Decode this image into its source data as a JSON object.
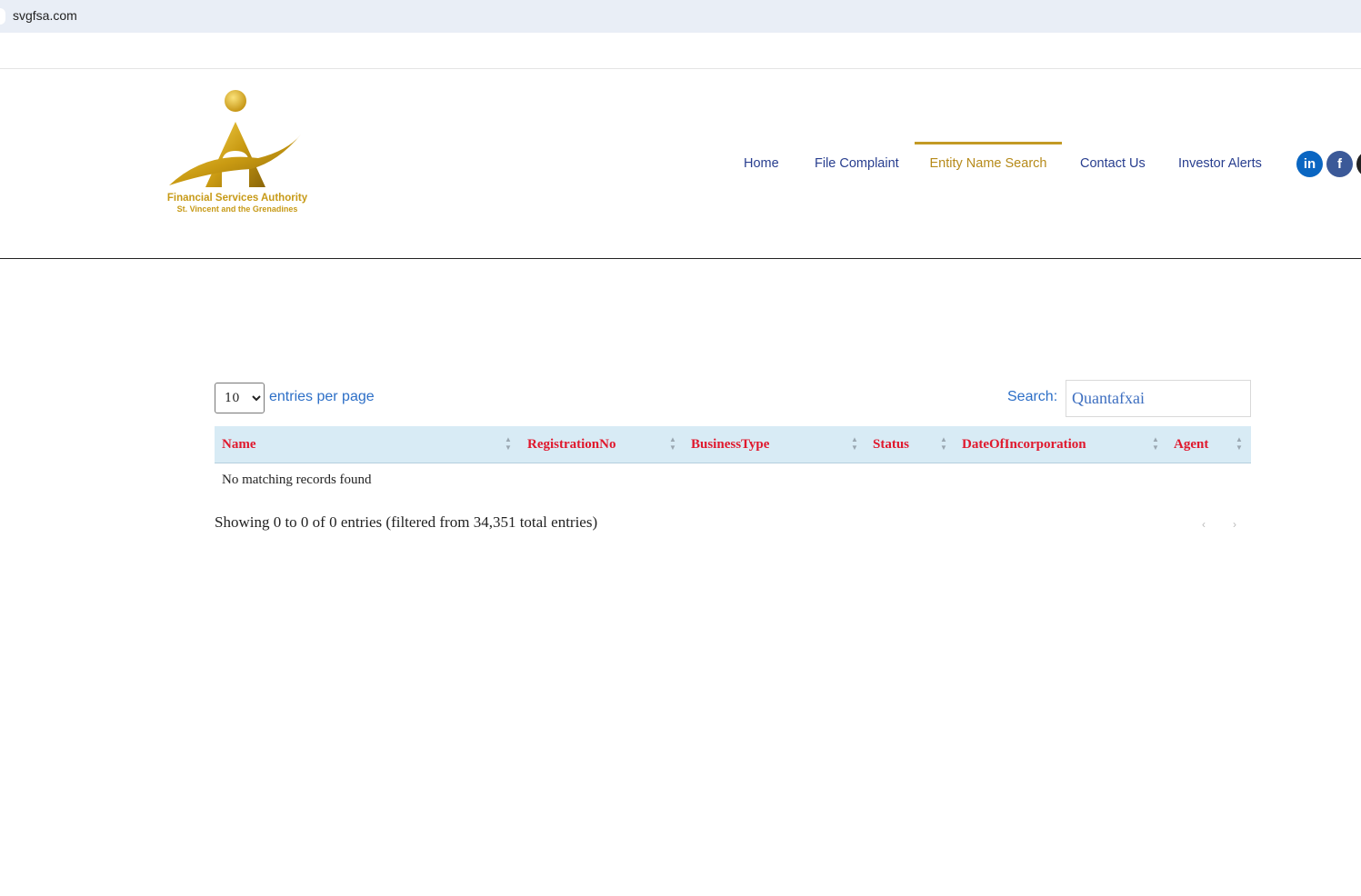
{
  "browser": {
    "url": "svgfsa.com"
  },
  "logo": {
    "line1": "Financial Services Authority",
    "line2": "St. Vincent and the Grenadines",
    "gold": "#c79a17"
  },
  "nav": {
    "items": [
      {
        "label": "Home",
        "active": false
      },
      {
        "label": "File Complaint",
        "active": false
      },
      {
        "label": "Entity Name Search",
        "active": true
      },
      {
        "label": "Contact Us",
        "active": false
      },
      {
        "label": "Investor Alerts",
        "active": false
      }
    ],
    "social": {
      "linkedin": "in",
      "facebook": "f"
    }
  },
  "table_controls": {
    "page_length_value": "10",
    "page_length_options": [
      "10"
    ],
    "page_length_label": "entries per page",
    "search_label": "Search:",
    "search_value": "Quantafxai"
  },
  "table": {
    "columns": [
      "Name",
      "RegistrationNo",
      "BusinessType",
      "Status",
      "DateOfIncorporation",
      "Agent"
    ],
    "empty_message": "No matching records found",
    "info": "Showing 0 to 0 of 0 entries (filtered from 34,351 total entries)",
    "prev_label": "‹",
    "next_label": "›"
  },
  "colors": {
    "nav_text": "#283e8f",
    "nav_active": "#b68a1a",
    "header_text": "#e0182d",
    "header_bg": "#d8ebf5",
    "control_blue": "#2d6fc7"
  }
}
